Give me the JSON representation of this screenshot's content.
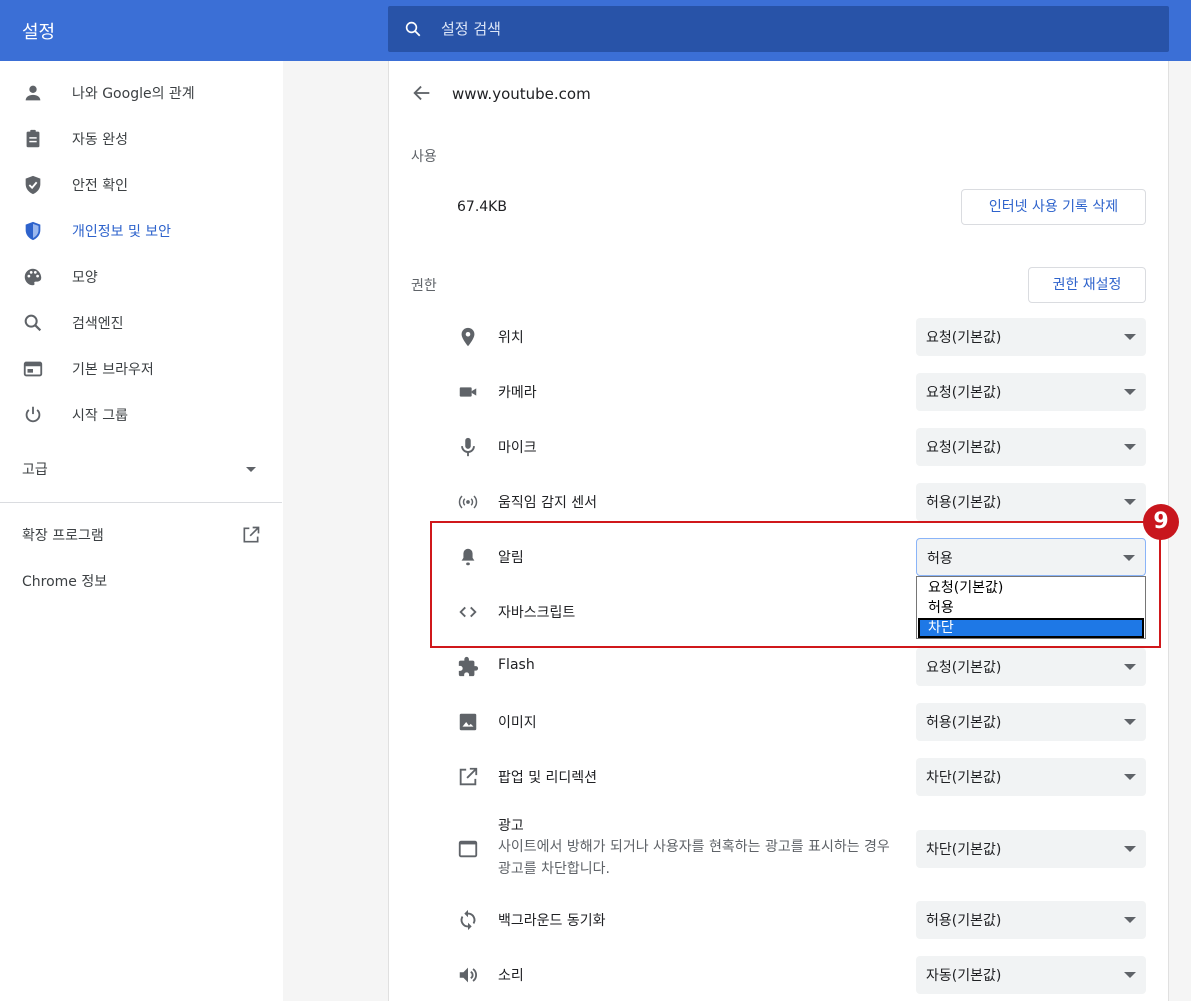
{
  "header": {
    "title": "설정",
    "search_placeholder": "설정 검색"
  },
  "sidebar": {
    "items": [
      {
        "label": "나와 Google의 관계",
        "icon": "person-icon"
      },
      {
        "label": "자동 완성",
        "icon": "clipboard-icon"
      },
      {
        "label": "안전 확인",
        "icon": "shield-check-icon"
      },
      {
        "label": "개인정보 및 보안",
        "icon": "shield-icon",
        "active": true
      },
      {
        "label": "모양",
        "icon": "palette-icon"
      },
      {
        "label": "검색엔진",
        "icon": "search-icon"
      },
      {
        "label": "기본 브라우저",
        "icon": "browser-icon"
      },
      {
        "label": "시작 그룹",
        "icon": "power-icon"
      }
    ],
    "advanced": "고급",
    "extensions": "확장 프로그램",
    "about": "Chrome 정보"
  },
  "site": {
    "title": "www.youtube.com",
    "usage_label": "사용",
    "usage_value": "67.4KB",
    "clear_button": "인터넷 사용 기록 삭제",
    "permissions_label": "권한",
    "reset_button": "권한 재설정"
  },
  "permissions": [
    {
      "label": "위치",
      "value": "요청(기본값)",
      "icon": "location-pin-icon"
    },
    {
      "label": "카메라",
      "value": "요청(기본값)",
      "icon": "camera-icon"
    },
    {
      "label": "마이크",
      "value": "요청(기본값)",
      "icon": "microphone-icon"
    },
    {
      "label": "움직임 감지 센서",
      "value": "허용(기본값)",
      "icon": "sensor-icon"
    },
    {
      "label": "알림",
      "value": "허용",
      "icon": "bell-icon"
    },
    {
      "label": "자바스크립트",
      "value": "",
      "icon": "code-icon"
    },
    {
      "label": "Flash",
      "value": "요청(기본값)",
      "icon": "puzzle-icon"
    },
    {
      "label": "이미지",
      "value": "허용(기본값)",
      "icon": "image-icon"
    },
    {
      "label": "팝업 및 리디렉션",
      "value": "차단(기본값)",
      "icon": "open-in-new-icon"
    },
    {
      "label": "광고",
      "description": "사이트에서 방해가 되거나 사용자를 현혹하는 광고를 표시하는 경우 광고를 차단합니다.",
      "value": "차단(기본값)",
      "icon": "ad-window-icon"
    },
    {
      "label": "백그라운드 동기화",
      "value": "허용(기본값)",
      "icon": "sync-icon"
    },
    {
      "label": "소리",
      "value": "자동(기본값)",
      "icon": "volume-icon"
    }
  ],
  "dropdown": {
    "options": [
      "요청(기본값)",
      "허용",
      "차단"
    ],
    "highlighted": "차단"
  },
  "annotation": {
    "badge": "9",
    "color": "#d0181b"
  },
  "colors": {
    "header": "#3b6fd6",
    "search": "#2853a8",
    "accent": "#2e63cc"
  }
}
